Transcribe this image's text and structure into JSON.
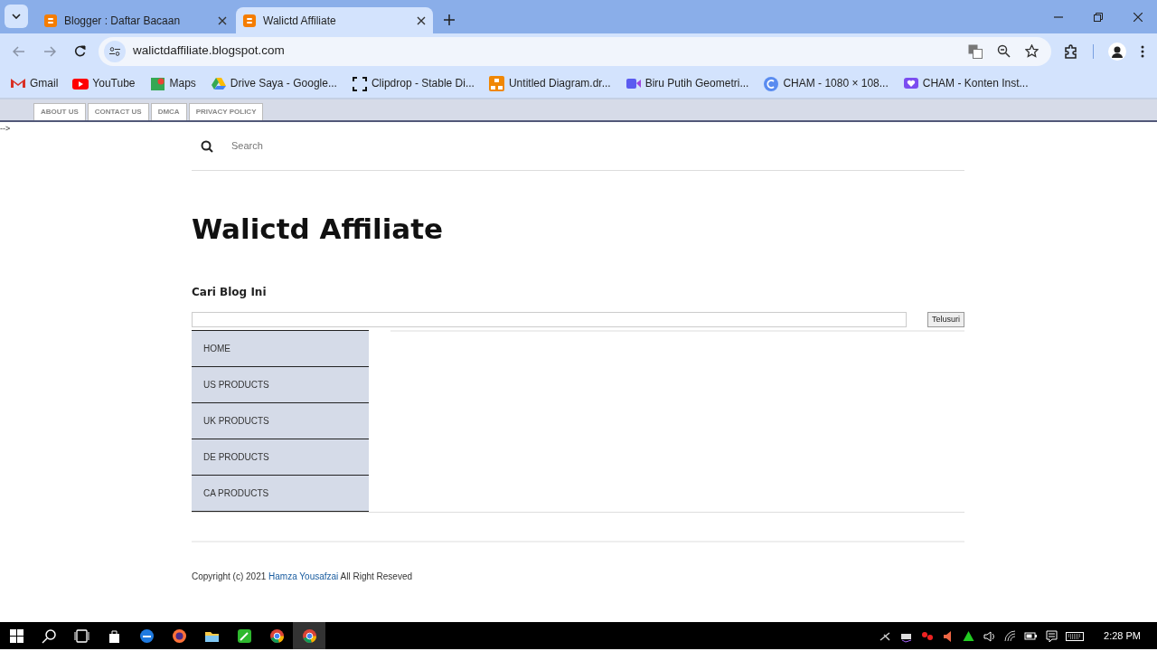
{
  "browser_tabs": [
    {
      "title": "Blogger : Daftar Bacaan",
      "selected": false
    },
    {
      "title": "Walictd Affiliate",
      "selected": true
    }
  ],
  "address_bar": {
    "url": "walictdaffiliate.blogspot.com"
  },
  "bookmarks": [
    {
      "label": "Gmail",
      "kind": "gmail"
    },
    {
      "label": "YouTube",
      "kind": "youtube"
    },
    {
      "label": "Maps",
      "kind": "maps"
    },
    {
      "label": "Drive Saya - Google...",
      "kind": "drive"
    },
    {
      "label": "Clipdrop - Stable Di...",
      "kind": "clipdrop"
    },
    {
      "label": "Untitled Diagram.dr...",
      "kind": "diagram"
    },
    {
      "label": "Biru Putih Geometri...",
      "kind": "video"
    },
    {
      "label": "CHAM - 1080 × 108...",
      "kind": "canva"
    },
    {
      "label": "CHAM - Konten Inst...",
      "kind": "heart"
    }
  ],
  "page": {
    "top_links": [
      "ABOUT US",
      "CONTACT US",
      "DMCA",
      "PRIVACY POLICY"
    ],
    "stray_text": "-->",
    "search": {
      "placeholder": "Search"
    },
    "blog_title": "Walictd Affiliate",
    "search_widget": {
      "heading": "Cari Blog Ini",
      "button": "Telusuri"
    },
    "menu": [
      "HOME",
      "US PRODUCTS",
      "UK PRODUCTS",
      "DE PRODUCTS",
      "CA PRODUCTS"
    ],
    "footer": {
      "before": "Copyright (c) 2021 ",
      "link": "Hamza Yousafzai",
      "after": " All Right Reseved"
    }
  },
  "taskbar": {
    "clock": "2:28 PM"
  }
}
